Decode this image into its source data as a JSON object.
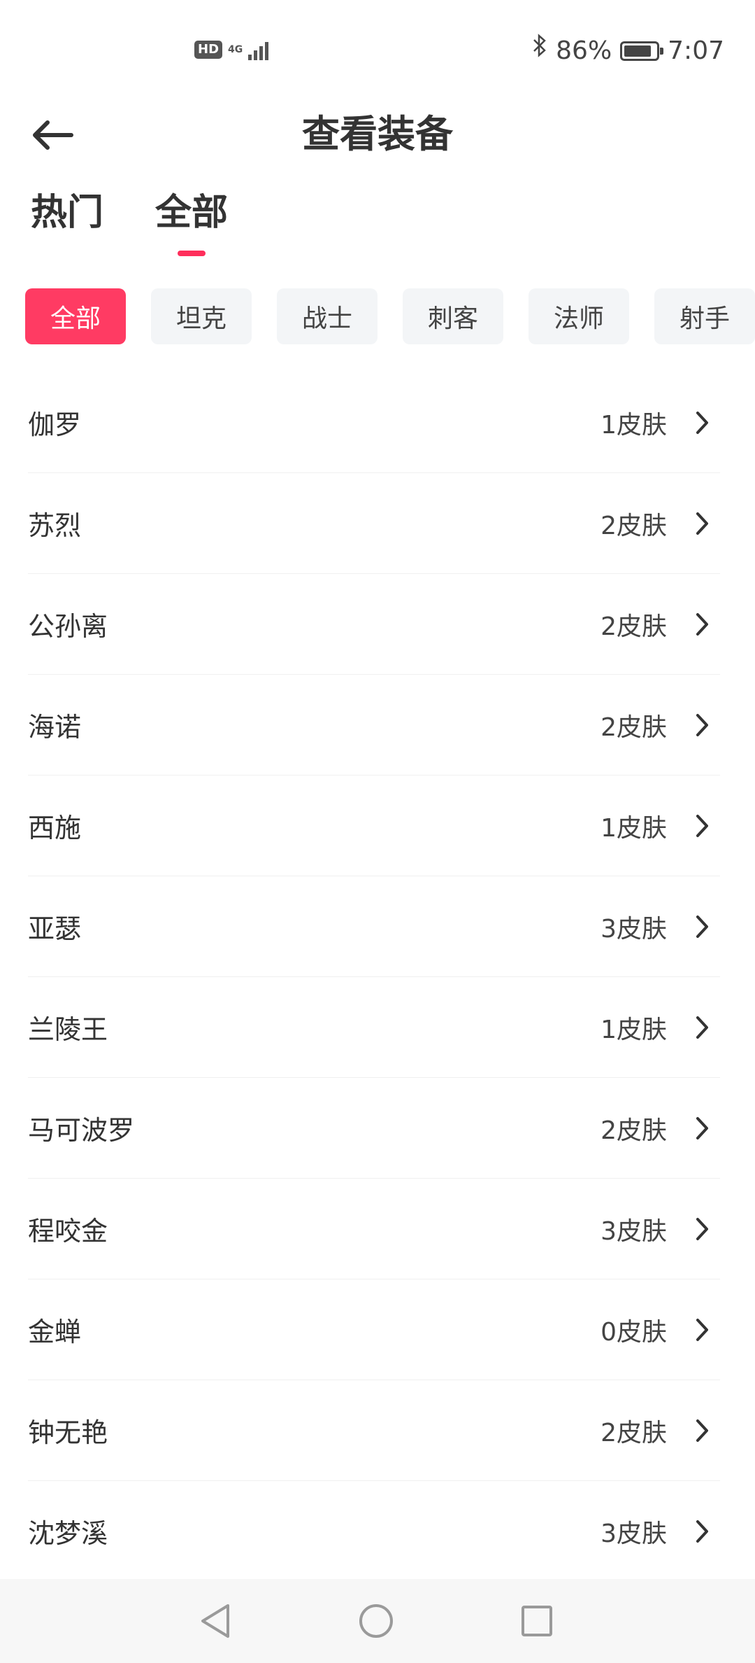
{
  "status_bar": {
    "hd_label": "HD",
    "network_label": "4G",
    "battery_percent": "86%",
    "battery_level": 0.86,
    "time": "7:07"
  },
  "header": {
    "title": "查看装备"
  },
  "top_tabs": [
    {
      "label": "热门",
      "active": false
    },
    {
      "label": "全部",
      "active": true
    }
  ],
  "chips": [
    {
      "label": "全部",
      "active": true
    },
    {
      "label": "坦克",
      "active": false
    },
    {
      "label": "战士",
      "active": false
    },
    {
      "label": "刺客",
      "active": false
    },
    {
      "label": "法师",
      "active": false
    },
    {
      "label": "射手",
      "active": false
    }
  ],
  "list": [
    {
      "name": "伽罗",
      "count": "1皮肤"
    },
    {
      "name": "苏烈",
      "count": "2皮肤"
    },
    {
      "name": "公孙离",
      "count": "2皮肤"
    },
    {
      "name": "海诺",
      "count": "2皮肤"
    },
    {
      "name": "西施",
      "count": "1皮肤"
    },
    {
      "name": "亚瑟",
      "count": "3皮肤"
    },
    {
      "name": "兰陵王",
      "count": "1皮肤"
    },
    {
      "name": "马可波罗",
      "count": "2皮肤"
    },
    {
      "name": "程咬金",
      "count": "3皮肤"
    },
    {
      "name": "金蝉",
      "count": "0皮肤"
    },
    {
      "name": "钟无艳",
      "count": "2皮肤"
    },
    {
      "name": "沈梦溪",
      "count": "3皮肤"
    }
  ],
  "colors": {
    "accent": "#ff3b63",
    "tab_indicator": "#ff2e5b",
    "chip_bg": "#f3f5f7",
    "nav_bar_bg": "#f7f7f7"
  },
  "icons": {
    "back": "arrow-left-icon",
    "row_chevron": "chevron-right-icon",
    "nav_back": "triangle-back-icon",
    "nav_home": "circle-home-icon",
    "nav_recent": "square-recent-icon"
  }
}
